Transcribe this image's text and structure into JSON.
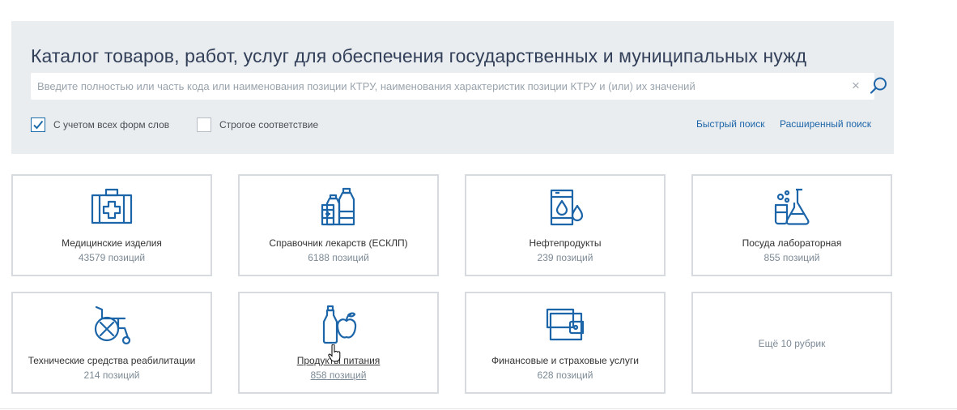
{
  "header": {
    "title": "Каталог товаров, работ, услуг для обеспечения государственных и муниципальных нужд"
  },
  "search": {
    "placeholder": "Введите полностью или часть кода или наименования позиции КТРУ, наименования характеристик позиции КТРУ и (или) их значений",
    "value": "",
    "clear_icon": "close-icon",
    "search_icon": "magnifier-icon"
  },
  "options": {
    "all_word_forms": {
      "label": "С учетом всех форм слов",
      "checked": true
    },
    "strict_match": {
      "label": "Строгое соответствие",
      "checked": false
    }
  },
  "links": {
    "quick_search": "Быстрый поиск",
    "advanced_search": "Расширенный поиск"
  },
  "categories": [
    {
      "title": "Медицинские изделия",
      "count": "43579 позиций",
      "icon": "medical-kit-icon"
    },
    {
      "title": "Справочник лекарств (ЕСКЛП)",
      "count": "6188 позиций",
      "icon": "medicine-bottles-icon"
    },
    {
      "title": "Нефтепродукты",
      "count": "239 позиций",
      "icon": "oil-barrel-icon"
    },
    {
      "title": "Посуда лабораторная",
      "count": "855 позиций",
      "icon": "lab-flask-icon"
    },
    {
      "title": "Технические средства реабилитации",
      "count": "214 позиций",
      "icon": "wheelchair-icon"
    },
    {
      "title": "Продукты питания",
      "count": "858 позиций",
      "icon": "food-bottle-apple-icon"
    },
    {
      "title": "Финансовые и страховые услуги",
      "count": "628 позиций",
      "icon": "wallet-icon"
    }
  ],
  "more": {
    "label": "Ещё 10 рубрик"
  },
  "colors": {
    "accent": "#1c65a8",
    "panel": "#eaedf0",
    "card_border": "#d7dbdf"
  }
}
